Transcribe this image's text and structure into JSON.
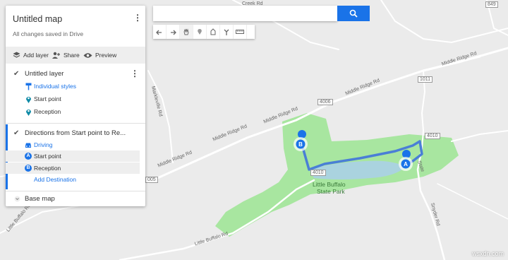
{
  "panel": {
    "map_title": "Untitled map",
    "save_status": "All changes saved in Drive",
    "toolbar": {
      "add_layer": "Add layer",
      "share": "Share",
      "preview": "Preview"
    },
    "layer1": {
      "title": "Untitled layer",
      "style_link": "Individual styles",
      "items": [
        {
          "label": "Start point"
        },
        {
          "label": "Reception"
        }
      ]
    },
    "layer2": {
      "title": "Directions from Start point  to Re...",
      "mode": "Driving",
      "stops": [
        {
          "letter": "A",
          "label": "Start point"
        },
        {
          "letter": "B",
          "label": "Reception"
        }
      ],
      "add_destination": "Add Destination"
    },
    "base_map": "Base map"
  },
  "map": {
    "labels": {
      "middle_ridge_1": "Middle Ridge Rd",
      "middle_ridge_2": "Middle Ridge Rd",
      "middle_ridge_3": "Middle Ridge Rd",
      "middle_ridge_4": "Middle Ridge Rd",
      "middle_ridge_5": "Middle Ridge Rd",
      "little_buffalo_rd": "Little Buffalo Rd",
      "park_name_1": "Little Buffalo",
      "park_name_2": "State Park",
      "little_buffalo_rd_left": "Little Buffalo Rd",
      "machine_rd": "Markleville Rd",
      "creek_rd": "Creek Rd",
      "state_rd": "State",
      "route_4006": "4006",
      "route_4010": "4010",
      "route_1011": "1011",
      "route_849": "849",
      "route_005": "005",
      "snyder_rd": "Snyder Rd",
      "little_buffalo_label": "4010"
    },
    "markers": {
      "a": "A",
      "b": "B"
    },
    "route_color": "#4a7fd6",
    "park_color": "#a8e6a0"
  },
  "watermark": "wsxdn.com"
}
